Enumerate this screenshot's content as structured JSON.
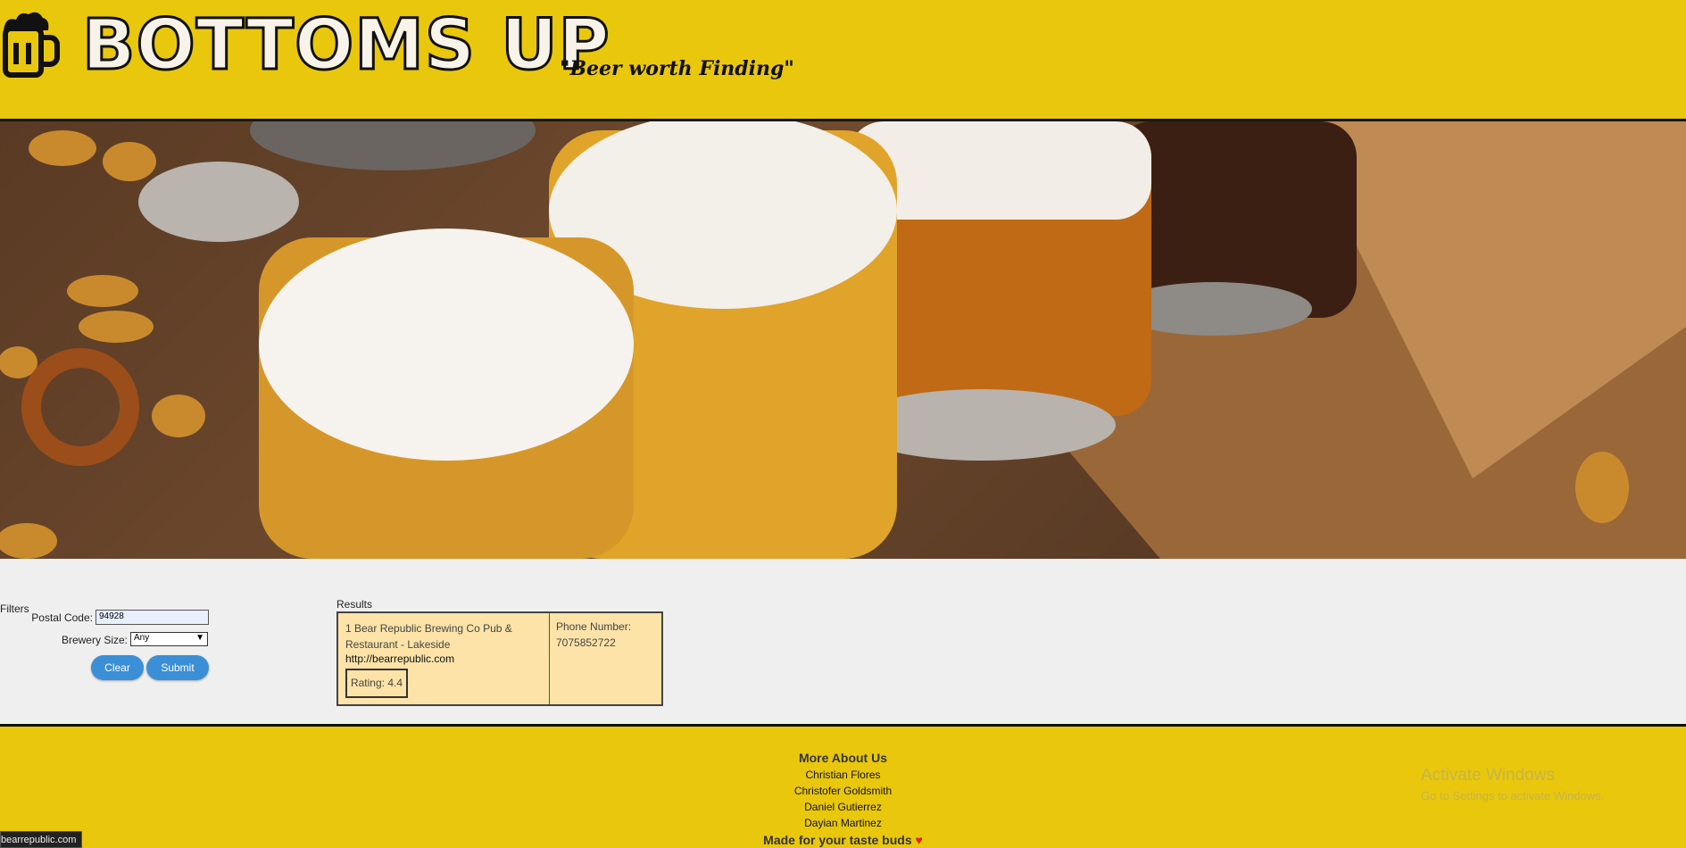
{
  "header": {
    "brand": "BOTTOMS UP",
    "tagline": "\"Beer worth Finding\"",
    "colors": {
      "header_bg": "#e9c70c",
      "brand_fill": "#f7f3e8"
    }
  },
  "hero": {
    "image": "beer-flight-photo"
  },
  "filters": {
    "title": "Filters",
    "postal_label": "Postal Code:",
    "postal_value": "94928",
    "size_label": "Brewery Size:",
    "size_selected": "Any",
    "clear_label": "Clear",
    "submit_label": "Submit"
  },
  "results": {
    "title": "Results",
    "items": [
      {
        "name": "1 Bear Republic Brewing Co Pub & Restaurant - Lakeside",
        "url": "http://bearrepublic.com",
        "rating": "Rating: 4.4",
        "phone_label": "Phone Number:",
        "phone": "7075852722"
      }
    ]
  },
  "footer": {
    "more_title": "More About Us",
    "members": [
      "Christian Flores",
      "Christofer Goldsmith",
      "Daniel Gutierrez",
      "Dayian Martinez"
    ],
    "made_text": "Made for your taste buds",
    "heart": "♥"
  },
  "watermark": {
    "title": "Activate Windows",
    "subtitle": "Go to Settings to activate Windows."
  },
  "status_bar": {
    "url": "bearrepublic.com"
  }
}
